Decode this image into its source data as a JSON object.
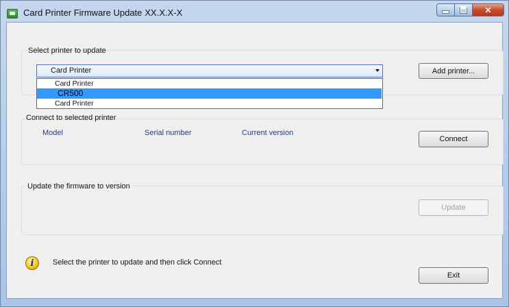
{
  "window": {
    "title": "Card Printer Firmware Update",
    "title_version": "XX.X.X-X"
  },
  "select_group": {
    "label": "Select printer to update",
    "combo_value": "Card Printer",
    "dropdown_options": [
      {
        "label": "Card Printer",
        "selected": false
      },
      {
        "label": "CR500",
        "selected": true
      },
      {
        "label": "Card Printer",
        "selected": false
      }
    ],
    "add_printer_label": "Add printer..."
  },
  "connect_group": {
    "label": "Connect to selected printer",
    "columns": [
      "Model",
      "Serial number",
      "Current version"
    ],
    "connect_label": "Connect"
  },
  "update_group": {
    "label": "Update the firmware to version",
    "update_label": "Update",
    "update_enabled": false
  },
  "status": {
    "icon": "info-icon",
    "message": "Select the printer to update and then click Connect"
  },
  "exit_label": "Exit",
  "colors": {
    "selection": "#3399ff",
    "column_header": "#1f3b8c",
    "close_button": "#c74a2a"
  }
}
